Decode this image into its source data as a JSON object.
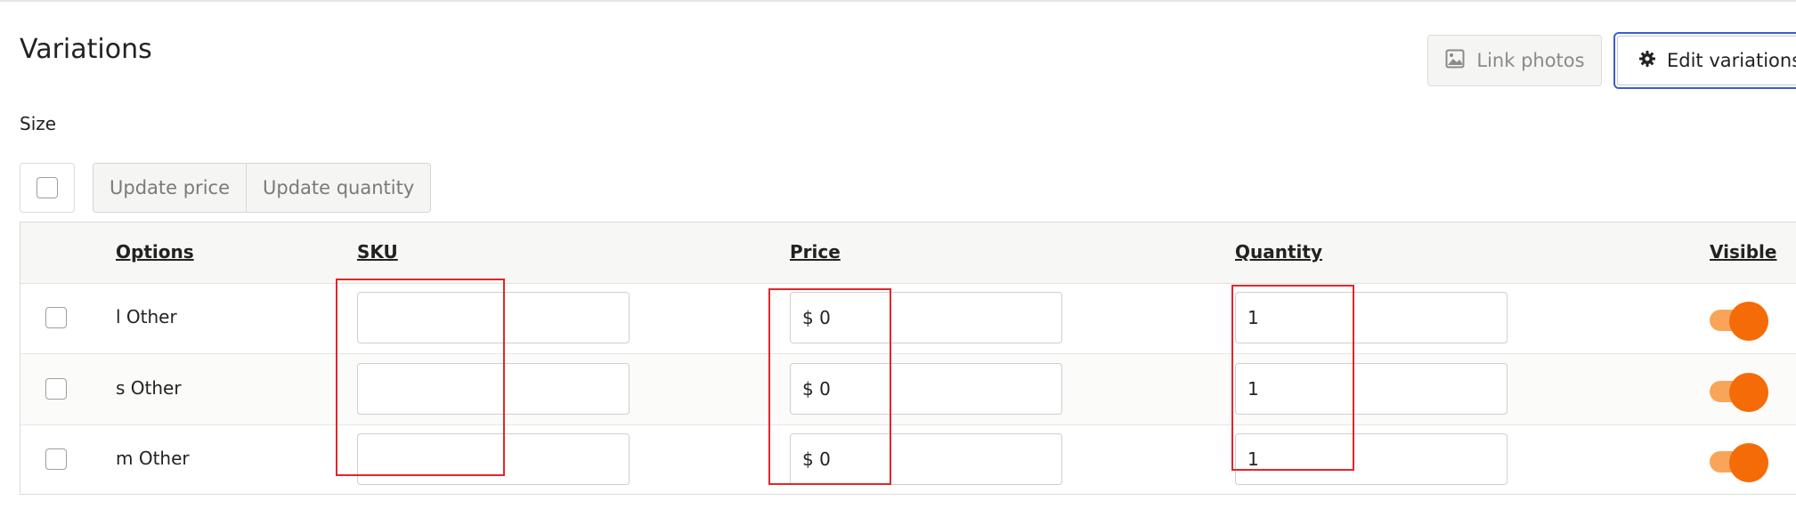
{
  "section": {
    "title": "Variations",
    "size_label": "Size"
  },
  "actions": {
    "link_photos": "Link photos",
    "edit_variations": "Edit variations"
  },
  "bulk": {
    "update_price": "Update price",
    "update_quantity": "Update quantity"
  },
  "table": {
    "headers": {
      "options": "Options",
      "sku": "SKU",
      "price": "Price",
      "quantity": "Quantity",
      "visible": "Visible"
    },
    "rows": [
      {
        "option": "l Other",
        "sku": "",
        "price": "$ 0",
        "quantity": "1",
        "visible": true
      },
      {
        "option": "s Other",
        "sku": "",
        "price": "$ 0",
        "quantity": "1",
        "visible": true
      },
      {
        "option": "m Other",
        "sku": "",
        "price": "$ 0",
        "quantity": "1",
        "visible": true
      }
    ]
  },
  "colors": {
    "toggle_on": "#f56b07",
    "toggle_track": "#f8a55a",
    "focus_border": "#3b5fc9",
    "annotation": "#e2262a"
  },
  "icons": {
    "link_photos": "image-icon",
    "edit_variations": "gear-icon"
  }
}
